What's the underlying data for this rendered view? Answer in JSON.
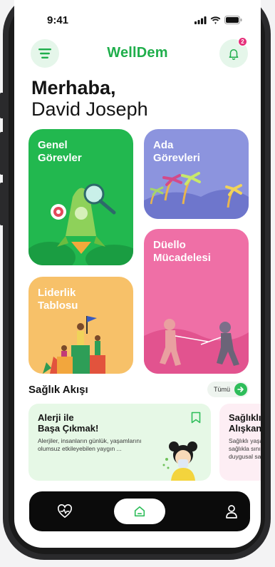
{
  "status": {
    "time": "9:41"
  },
  "header": {
    "logo": "WellDem",
    "notification_count": "2"
  },
  "greeting": {
    "line1": "Merhaba,",
    "line2": "David Joseph"
  },
  "cards": [
    {
      "title": "Genel\nGörevler",
      "color": "#22b84f"
    },
    {
      "title": "Ada\nGörevleri",
      "color": "#8c94de"
    },
    {
      "title": "Düello\nMücadelesi",
      "color": "#ef6fa6"
    },
    {
      "title": "Liderlik\nTablosu",
      "color": "#f7c169"
    }
  ],
  "feed": {
    "title": "Sağlık Akışı",
    "all_label": "Tümü",
    "items": [
      {
        "title": "Alerji ile\nBaşa Çıkmak!",
        "text": "Alerjiler, insanların günlük, yaşamlarını olumsuz etkileyebilen yaygın ...",
        "bg": "#e6f8e6"
      },
      {
        "title": "Sağlıklı Yaş\nAlışkanlıkla",
        "text": "Sağlıklı yaşam, y sağlıkla sınırlı ol duygusal sağlığ",
        "bg": "#fdeef4"
      }
    ]
  },
  "tabbar": {
    "items": [
      "heart-pulse-icon",
      "home-icon",
      "profile-icon"
    ],
    "active": "home-icon"
  },
  "colors": {
    "brand": "#1fae4b",
    "accent": "#2ebd5a",
    "badge": "#e5307a"
  }
}
